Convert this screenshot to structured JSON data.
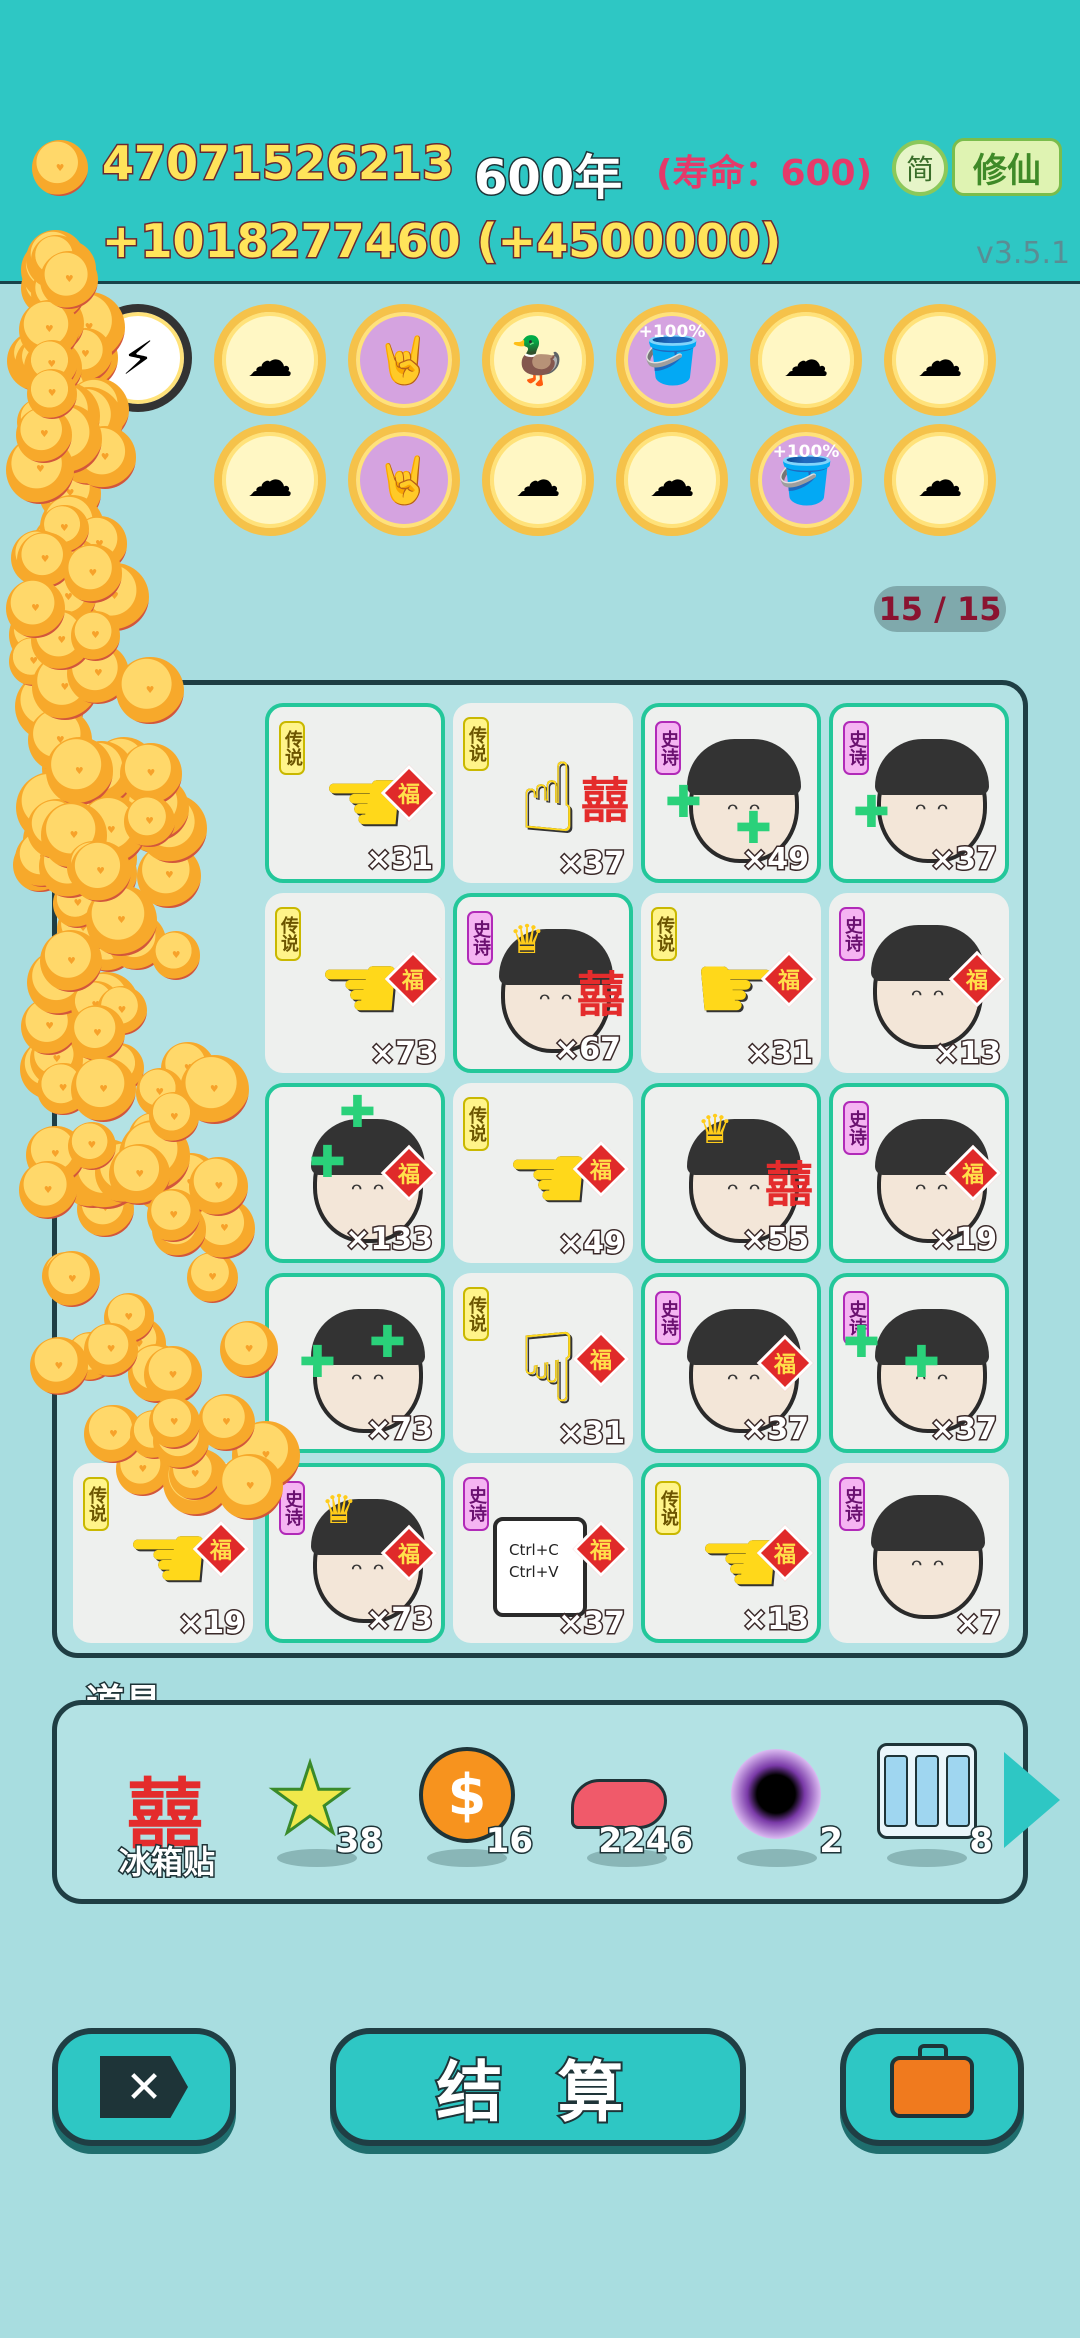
{
  "header": {
    "coins": "47071526213",
    "year": "600年",
    "lifespan": "(寿命：600)",
    "income": "+1018277460 (+4500000)",
    "lang_label": "简",
    "cultivate_label": "修仙",
    "version": "v3.5.1",
    "accent_color": "#2ec7c4"
  },
  "badges": {
    "row1": [
      {
        "icon": "lightning-icon"
      },
      {
        "icon": "mushroom-cloud-icon"
      },
      {
        "icon": "rock-hand-icon"
      },
      {
        "icon": "duck-pot-icon"
      },
      {
        "icon": "bucket-icon",
        "pct": "+100%"
      },
      {
        "icon": "mushroom-cloud-icon"
      },
      {
        "icon": "mushroom-cloud-icon"
      }
    ],
    "row2": [
      {
        "icon": "mushroom-cloud-icon"
      },
      {
        "icon": "rock-hand-icon"
      },
      {
        "icon": "mushroom-cloud-icon"
      },
      {
        "icon": "mushroom-cloud-icon"
      },
      {
        "icon": "bucket-icon",
        "pct": "+100%"
      },
      {
        "icon": "mushroom-cloud-icon"
      }
    ]
  },
  "board": {
    "counter": "15 / 15",
    "tag_legend": "传说",
    "tag_epic": "史诗",
    "fu_label": "福",
    "xi_label": "囍",
    "clip_line1": "Ctrl+C",
    "clip_line2": "Ctrl+V",
    "tiles": [
      {
        "count": "×31"
      },
      {
        "count": "×37"
      },
      {
        "count": "×49"
      },
      {
        "count": "×37"
      },
      {
        "count": "×73"
      },
      {
        "count": "×67"
      },
      {
        "count": "×31"
      },
      {
        "count": "×13"
      },
      {
        "count": "×133"
      },
      {
        "count": "×49"
      },
      {
        "count": "×55"
      },
      {
        "count": "×19"
      },
      {
        "count": "×73"
      },
      {
        "count": "×31"
      },
      {
        "count": "×37"
      },
      {
        "count": "×37"
      },
      {
        "count": "×19"
      },
      {
        "count": "×73"
      },
      {
        "count": "×37"
      },
      {
        "count": "×13"
      },
      {
        "count": "×7"
      }
    ]
  },
  "tools": {
    "label": "道具",
    "items": [
      {
        "icon": "fridge-sticker-icon",
        "name": "冰箱贴",
        "count": ""
      },
      {
        "icon": "star-icon",
        "count": "38"
      },
      {
        "icon": "dollar-coin-icon",
        "count": "16"
      },
      {
        "icon": "liver-icon",
        "count": "2246"
      },
      {
        "icon": "black-hole-icon",
        "count": "2"
      },
      {
        "icon": "vending-machine-icon",
        "count": "8"
      }
    ]
  },
  "actions": {
    "close_icon": "close-icon",
    "settle_label": "结 算",
    "bag_icon": "briefcase-icon"
  }
}
